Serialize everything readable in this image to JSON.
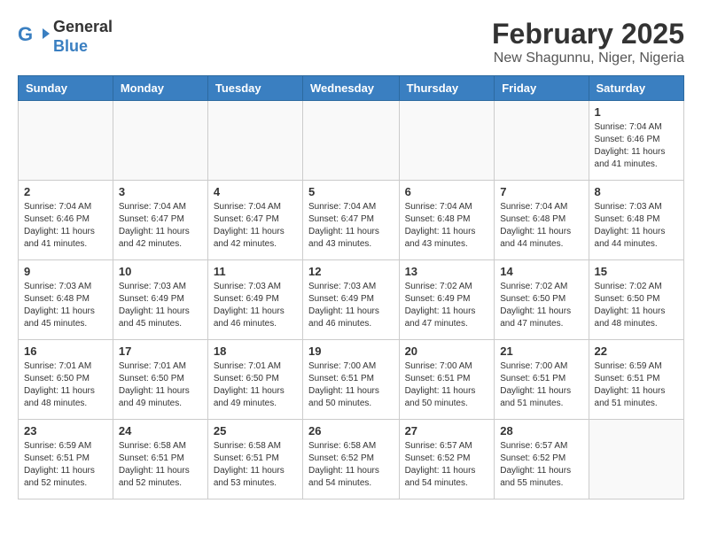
{
  "logo": {
    "line1": "General",
    "line2": "Blue"
  },
  "title": "February 2025",
  "subtitle": "New Shagunnu, Niger, Nigeria",
  "days_of_week": [
    "Sunday",
    "Monday",
    "Tuesday",
    "Wednesday",
    "Thursday",
    "Friday",
    "Saturday"
  ],
  "weeks": [
    [
      {
        "day": "",
        "info": ""
      },
      {
        "day": "",
        "info": ""
      },
      {
        "day": "",
        "info": ""
      },
      {
        "day": "",
        "info": ""
      },
      {
        "day": "",
        "info": ""
      },
      {
        "day": "",
        "info": ""
      },
      {
        "day": "1",
        "info": "Sunrise: 7:04 AM\nSunset: 6:46 PM\nDaylight: 11 hours and 41 minutes."
      }
    ],
    [
      {
        "day": "2",
        "info": "Sunrise: 7:04 AM\nSunset: 6:46 PM\nDaylight: 11 hours and 41 minutes."
      },
      {
        "day": "3",
        "info": "Sunrise: 7:04 AM\nSunset: 6:47 PM\nDaylight: 11 hours and 42 minutes."
      },
      {
        "day": "4",
        "info": "Sunrise: 7:04 AM\nSunset: 6:47 PM\nDaylight: 11 hours and 42 minutes."
      },
      {
        "day": "5",
        "info": "Sunrise: 7:04 AM\nSunset: 6:47 PM\nDaylight: 11 hours and 43 minutes."
      },
      {
        "day": "6",
        "info": "Sunrise: 7:04 AM\nSunset: 6:48 PM\nDaylight: 11 hours and 43 minutes."
      },
      {
        "day": "7",
        "info": "Sunrise: 7:04 AM\nSunset: 6:48 PM\nDaylight: 11 hours and 44 minutes."
      },
      {
        "day": "8",
        "info": "Sunrise: 7:03 AM\nSunset: 6:48 PM\nDaylight: 11 hours and 44 minutes."
      }
    ],
    [
      {
        "day": "9",
        "info": "Sunrise: 7:03 AM\nSunset: 6:48 PM\nDaylight: 11 hours and 45 minutes."
      },
      {
        "day": "10",
        "info": "Sunrise: 7:03 AM\nSunset: 6:49 PM\nDaylight: 11 hours and 45 minutes."
      },
      {
        "day": "11",
        "info": "Sunrise: 7:03 AM\nSunset: 6:49 PM\nDaylight: 11 hours and 46 minutes."
      },
      {
        "day": "12",
        "info": "Sunrise: 7:03 AM\nSunset: 6:49 PM\nDaylight: 11 hours and 46 minutes."
      },
      {
        "day": "13",
        "info": "Sunrise: 7:02 AM\nSunset: 6:49 PM\nDaylight: 11 hours and 47 minutes."
      },
      {
        "day": "14",
        "info": "Sunrise: 7:02 AM\nSunset: 6:50 PM\nDaylight: 11 hours and 47 minutes."
      },
      {
        "day": "15",
        "info": "Sunrise: 7:02 AM\nSunset: 6:50 PM\nDaylight: 11 hours and 48 minutes."
      }
    ],
    [
      {
        "day": "16",
        "info": "Sunrise: 7:01 AM\nSunset: 6:50 PM\nDaylight: 11 hours and 48 minutes."
      },
      {
        "day": "17",
        "info": "Sunrise: 7:01 AM\nSunset: 6:50 PM\nDaylight: 11 hours and 49 minutes."
      },
      {
        "day": "18",
        "info": "Sunrise: 7:01 AM\nSunset: 6:50 PM\nDaylight: 11 hours and 49 minutes."
      },
      {
        "day": "19",
        "info": "Sunrise: 7:00 AM\nSunset: 6:51 PM\nDaylight: 11 hours and 50 minutes."
      },
      {
        "day": "20",
        "info": "Sunrise: 7:00 AM\nSunset: 6:51 PM\nDaylight: 11 hours and 50 minutes."
      },
      {
        "day": "21",
        "info": "Sunrise: 7:00 AM\nSunset: 6:51 PM\nDaylight: 11 hours and 51 minutes."
      },
      {
        "day": "22",
        "info": "Sunrise: 6:59 AM\nSunset: 6:51 PM\nDaylight: 11 hours and 51 minutes."
      }
    ],
    [
      {
        "day": "23",
        "info": "Sunrise: 6:59 AM\nSunset: 6:51 PM\nDaylight: 11 hours and 52 minutes."
      },
      {
        "day": "24",
        "info": "Sunrise: 6:58 AM\nSunset: 6:51 PM\nDaylight: 11 hours and 52 minutes."
      },
      {
        "day": "25",
        "info": "Sunrise: 6:58 AM\nSunset: 6:51 PM\nDaylight: 11 hours and 53 minutes."
      },
      {
        "day": "26",
        "info": "Sunrise: 6:58 AM\nSunset: 6:52 PM\nDaylight: 11 hours and 54 minutes."
      },
      {
        "day": "27",
        "info": "Sunrise: 6:57 AM\nSunset: 6:52 PM\nDaylight: 11 hours and 54 minutes."
      },
      {
        "day": "28",
        "info": "Sunrise: 6:57 AM\nSunset: 6:52 PM\nDaylight: 11 hours and 55 minutes."
      },
      {
        "day": "",
        "info": ""
      }
    ]
  ]
}
